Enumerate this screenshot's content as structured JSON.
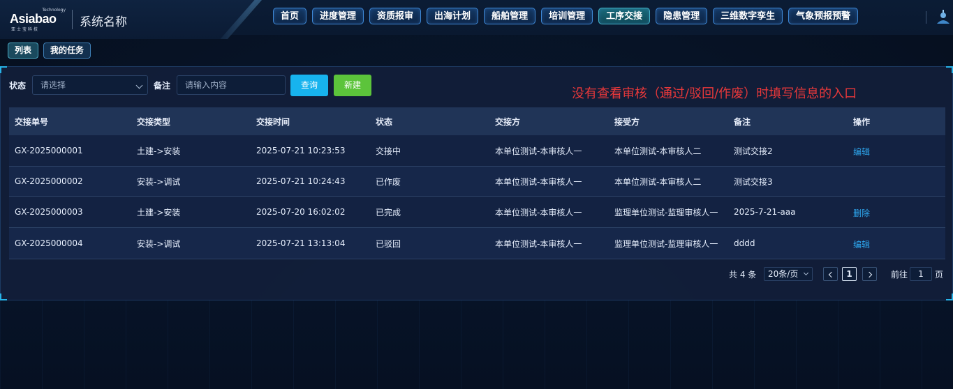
{
  "brand": {
    "logo_text": "Asiabao",
    "logo_tech": "Technology",
    "logo_sub": "亚士宝科技",
    "system_name": "系统名称"
  },
  "nav": {
    "items": [
      {
        "label": "首页"
      },
      {
        "label": "进度管理"
      },
      {
        "label": "资质报审"
      },
      {
        "label": "出海计划"
      },
      {
        "label": "船舶管理"
      },
      {
        "label": "培训管理"
      },
      {
        "label": "工序交接",
        "active": true
      },
      {
        "label": "隐患管理"
      },
      {
        "label": "三维数字孪生"
      },
      {
        "label": "气象预报预警"
      }
    ]
  },
  "subtabs": [
    {
      "label": "列表",
      "active": true
    },
    {
      "label": "我的任务"
    }
  ],
  "filters": {
    "status_label": "状态",
    "status_placeholder": "请选择",
    "remark_label": "备注",
    "remark_placeholder": "请输入内容",
    "query_button": "查询",
    "new_button": "新建"
  },
  "annotation": "没有查看审核（通过/驳回/作废）时填写信息的入口",
  "table": {
    "headers": [
      "交接单号",
      "交接类型",
      "交接时间",
      "状态",
      "交接方",
      "接受方",
      "备注",
      "操作"
    ],
    "rows": [
      {
        "id": "GX-2025000001",
        "type": "土建->安装",
        "time": "2025-07-21 10:23:53",
        "status": "交接中",
        "from": "本单位测试-本审核人一",
        "to": "本单位测试-本审核人二",
        "remark": "测试交接2",
        "action": "编辑"
      },
      {
        "id": "GX-2025000002",
        "type": "安装->调试",
        "time": "2025-07-21 10:24:43",
        "status": "已作废",
        "from": "本单位测试-本审核人一",
        "to": "本单位测试-本审核人二",
        "remark": "测试交接3",
        "action": ""
      },
      {
        "id": "GX-2025000003",
        "type": "土建->安装",
        "time": "2025-07-20 16:02:02",
        "status": "已完成",
        "from": "本单位测试-本审核人一",
        "to": "监理单位测试-监理审核人一",
        "remark": "2025-7-21-aaa",
        "action": "删除"
      },
      {
        "id": "GX-2025000004",
        "type": "安装->调试",
        "time": "2025-07-21 13:13:04",
        "status": "已驳回",
        "from": "本单位测试-本审核人一",
        "to": "监理单位测试-监理审核人一",
        "remark": "dddd",
        "action": "编辑"
      }
    ]
  },
  "pagination": {
    "total_text": "共 4 条",
    "page_size": "20条/页",
    "current_page": "1",
    "goto_label": "前往",
    "goto_value": "1",
    "goto_suffix": "页"
  },
  "colors": {
    "accent": "#17b3ee",
    "new_button": "#5cc43b",
    "annotation": "#e8383a",
    "link": "#2ea8f0"
  }
}
